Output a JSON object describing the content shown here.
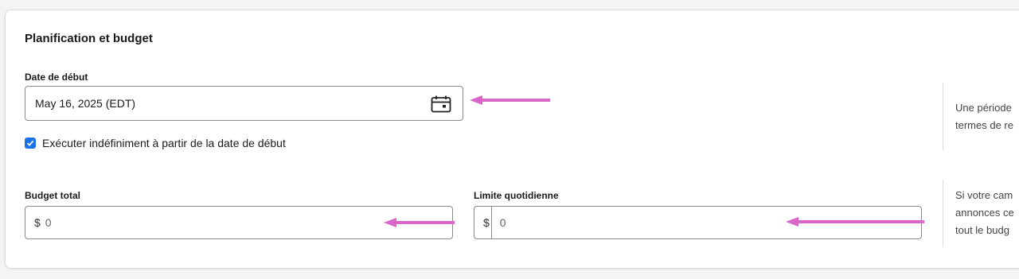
{
  "section": {
    "title": "Planification et budget"
  },
  "start_date": {
    "label": "Date de début",
    "value": "May 16, 2025 (EDT)",
    "icon": "calendar-icon"
  },
  "run_indefinitely": {
    "label": "Exécuter indéfiniment à partir de la date de début",
    "checked": true
  },
  "total_budget": {
    "label": "Budget total",
    "currency": "$",
    "value": "0"
  },
  "daily_limit": {
    "label": "Limite quotidienne",
    "currency": "$",
    "value": "0"
  },
  "help_texts": {
    "date": [
      "Une période",
      "termes de re"
    ],
    "budget": [
      "Si votre cam",
      "annonces ce",
      "tout le budg"
    ]
  },
  "colors": {
    "accent": "#1a73e8",
    "annotation_arrow": "#d966c8"
  }
}
